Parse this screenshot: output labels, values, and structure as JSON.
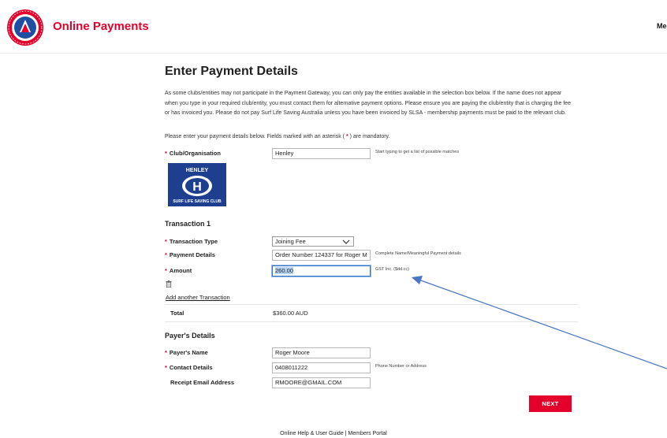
{
  "colors": {
    "brand_red": "#e4002b",
    "focus_blue": "#3a78c6",
    "annotation_arrow": "#4a74c4"
  },
  "header": {
    "logo_icon": "surf-life-saving-logo",
    "brand_text": "Online Payments",
    "menu_label": "Me"
  },
  "page": {
    "title": "Enter Payment Details",
    "intro": "As some clubs/entities may not participate in the Payment Gateway, you can only pay the entities available in the selection box below. If the name does not appear when you type in your required club/entity, you must contact them for alternative payment options. Please ensure you are paying the club/entity that is charging the fee or has invoiced you. Please do not pay Surf Life Saving Australia unless you have been invoiced by SLSA - membership payments must be paid to the relevant club.",
    "mandatory_prefix": "Please enter your payment details below. Fields marked with an asterisk (",
    "mandatory_asterisk": "*",
    "mandatory_suffix": ") are mandatory."
  },
  "club": {
    "label": "Club/Organisation",
    "value": "Henley",
    "hint": "Start typing to get a list of possible matches",
    "logo_lines": [
      "HENLEY",
      "SURF LIFE SAVING CLUB"
    ],
    "logo_letter": "H"
  },
  "transaction": {
    "heading": "Transaction 1",
    "type_label": "Transaction Type",
    "type_value": "Joining Fee",
    "details_label": "Payment Details",
    "details_value": "Order Number 124337 for Roger M",
    "details_hint": "Complete Name/Meaningful Payment details",
    "amount_label": "Amount",
    "amount_value": "260.00",
    "amount_hint": "GST Inc. ($dd.cc)",
    "delete_icon": "trash-icon",
    "add_link": "Add another Transaction",
    "total_label": "Total",
    "total_value": "$360.00 AUD"
  },
  "payer": {
    "heading": "Payer's Details",
    "name_label": "Payer's Name",
    "name_value": "Roger Moore",
    "contact_label": "Contact Details",
    "contact_value": "0408011222",
    "contact_hint": "Phone Number or Address",
    "email_label": "Receipt Email Address",
    "email_value": "RMOORE@GMAIL.COM"
  },
  "actions": {
    "next_label": "NEXT"
  },
  "footer": {
    "links": "Online Help & User Guide | Members Portal"
  }
}
